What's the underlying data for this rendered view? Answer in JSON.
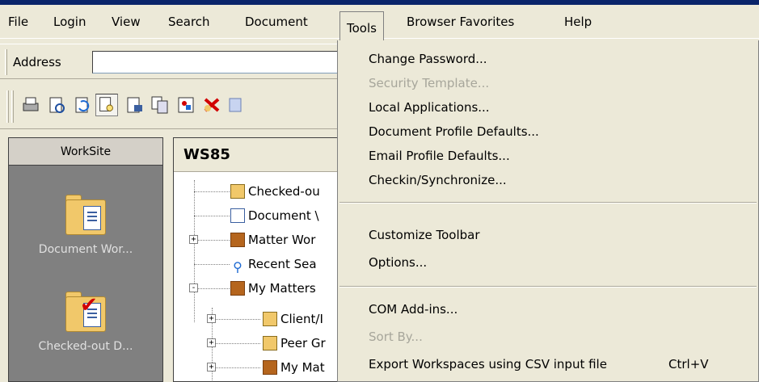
{
  "menubar": {
    "items": [
      {
        "label": "File"
      },
      {
        "label": "Login"
      },
      {
        "label": "View"
      },
      {
        "label": "Search"
      },
      {
        "label": "Document"
      },
      {
        "label": "Tools"
      },
      {
        "label": "Browser Favorites"
      },
      {
        "label": "Help"
      }
    ],
    "open_menu": "Tools"
  },
  "address_bar": {
    "label": "Address",
    "value": ""
  },
  "toolbar": {
    "icons": [
      "print-icon",
      "print-preview-icon",
      "refresh-icon",
      "preview-icon",
      "document-icon",
      "copy-icon",
      "image-icon",
      "delete-icon",
      "more-icon"
    ]
  },
  "left_pane": {
    "header": "WorkSite",
    "items": [
      {
        "label": "Document Wor...",
        "icon": "document-folder-icon"
      },
      {
        "label": "Checked-out D...",
        "icon": "checked-out-folder-icon"
      }
    ]
  },
  "right_pane": {
    "header": "WS85",
    "tree": [
      {
        "label": "Checked-ou",
        "icon": "checked-out-folder-icon"
      },
      {
        "label": "Document \\",
        "icon": "document-folder-icon"
      },
      {
        "label": "Matter Wor",
        "icon": "matter-folder-icon"
      },
      {
        "label": "Recent Sea",
        "icon": "search-icon"
      },
      {
        "label": "My Matters",
        "icon": "my-matters-icon"
      },
      {
        "label": "Client/I",
        "icon": "folder-icon"
      },
      {
        "label": "Peer Gr",
        "icon": "folder-icon"
      },
      {
        "label": "My Mat",
        "icon": "my-matters-icon"
      }
    ]
  },
  "tools_menu": {
    "items": [
      {
        "label": "Change Password...",
        "enabled": true
      },
      {
        "label": "Security Template...",
        "enabled": false
      },
      {
        "label": "Local Applications...",
        "enabled": true
      },
      {
        "label": "Document Profile Defaults...",
        "enabled": true
      },
      {
        "label": "Email Profile Defaults...",
        "enabled": true
      },
      {
        "label": "Checkin/Synchronize...",
        "enabled": true
      },
      {
        "label": "Customize Toolbar",
        "enabled": true
      },
      {
        "label": "Options...",
        "enabled": true
      },
      {
        "label": "COM Add-ins...",
        "enabled": true
      },
      {
        "label": "Sort By...",
        "enabled": false
      },
      {
        "label": "Export Workspaces using CSV input file",
        "shortcut": "Ctrl+V",
        "enabled": true
      }
    ]
  },
  "colors": {
    "menu_bg": "#ece9d8",
    "disabled_text": "#a7a69b",
    "left_pane_bg": "#808080"
  }
}
